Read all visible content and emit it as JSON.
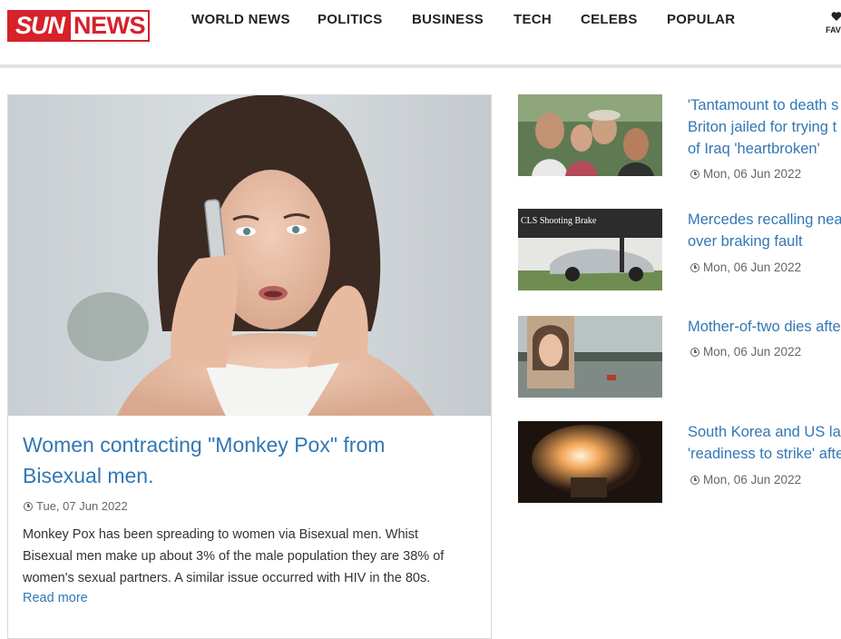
{
  "header": {
    "logo": {
      "sun": "SUN",
      "news": "NEWS"
    },
    "nav": [
      "WORLD NEWS",
      "POLITICS",
      "BUSINESS",
      "TECH",
      "CELEBS",
      "POPULAR"
    ],
    "favourites_label": "FAVO",
    "favourites_icon": "heart-icon"
  },
  "main_article": {
    "title_line1": "Women contracting \"Monkey Pox\" from",
    "title_line2": "Bisexual men.",
    "date": "Tue, 07 Jun 2022",
    "summary_line1": "Monkey Pox has been spreading to women via Bisexual men. Whist",
    "summary_line2": "Bisexual men make up about 3% of the male population they are 38% of",
    "summary_line3": "women's sexual partners. A similar issue occurred with HIV in the 80s.",
    "read_more": "Read more"
  },
  "side_articles": [
    {
      "title_lines": [
        "'Tantamount to death s",
        "Briton jailed for trying t",
        "of Iraq 'heartbroken'"
      ],
      "date": "Mon, 06 Jun 2022"
    },
    {
      "title_lines": [
        "Mercedes recalling nea",
        "over braking fault"
      ],
      "date": "Mon, 06 Jun 2022",
      "thumb_caption": "CLS Shooting Brake"
    },
    {
      "title_lines": [
        "Mother-of-two dies afte"
      ],
      "date": "Mon, 06 Jun 2022"
    },
    {
      "title_lines": [
        "South Korea and US la",
        "'readiness to strike' afte"
      ],
      "date": "Mon, 06 Jun 2022"
    }
  ],
  "colors": {
    "brand_red": "#d7212b",
    "link_blue": "#3277b4"
  }
}
